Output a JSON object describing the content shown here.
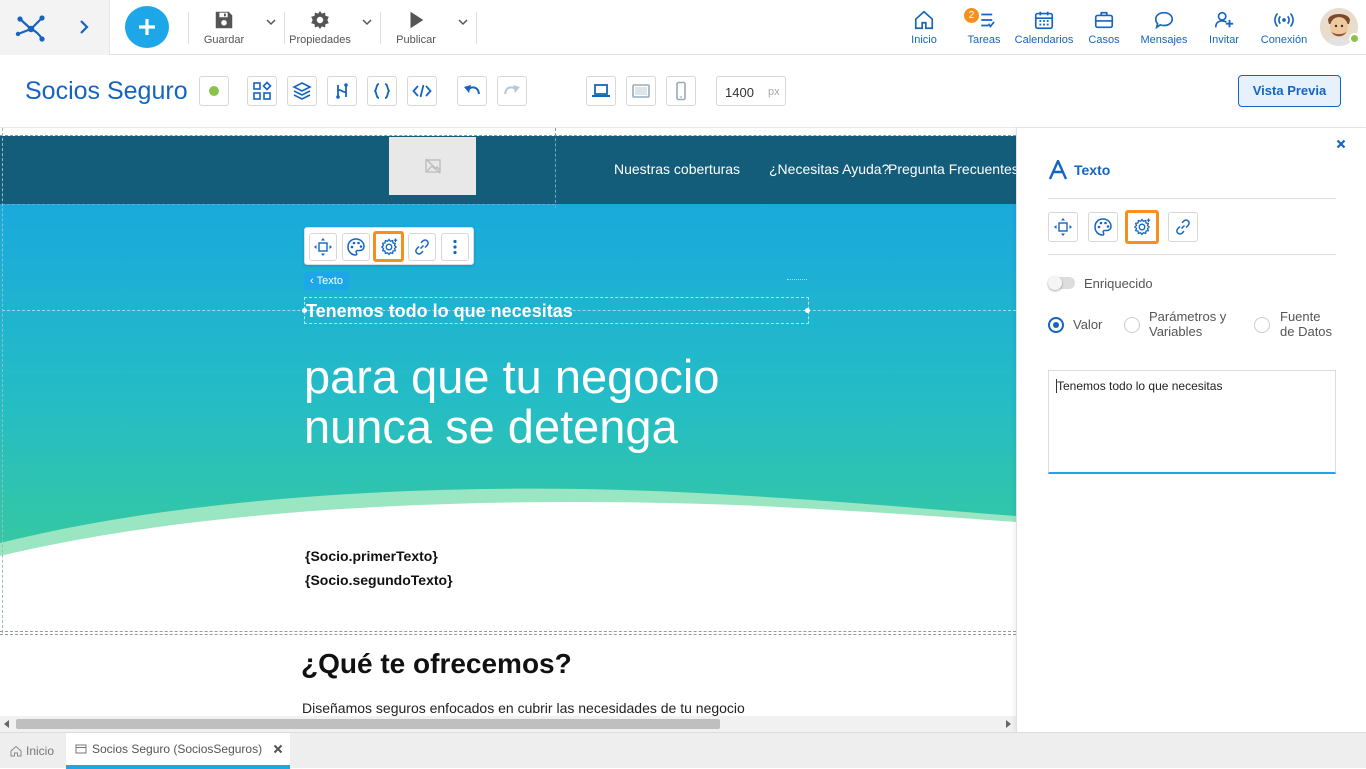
{
  "topbar": {
    "save_label": "Guardar",
    "properties_label": "Propiedades",
    "publish_label": "Publicar",
    "nav": [
      {
        "label": "Inicio",
        "icon": "home-icon"
      },
      {
        "label": "Tareas",
        "icon": "tasks-icon",
        "badge": "2"
      },
      {
        "label": "Calendarios",
        "icon": "calendar-icon"
      },
      {
        "label": "Casos",
        "icon": "briefcase-icon"
      },
      {
        "label": "Mensajes",
        "icon": "chat-icon"
      },
      {
        "label": "Invitar",
        "icon": "add-user-icon"
      },
      {
        "label": "Conexión",
        "icon": "connection-icon"
      }
    ]
  },
  "toolbar": {
    "page_title": "Socios Seguro",
    "width_value": "1400",
    "width_unit": "px",
    "preview_label": "Vista Previa"
  },
  "canvas": {
    "nav_links": [
      "Nuestras coberturas",
      "¿Necesitas Ayuda?",
      "Pregunta Frecuentes"
    ],
    "element_tag": "Texto",
    "hero_small": "Tenemos todo lo que necesitas",
    "hero_line1": "para que tu negocio",
    "hero_line2": "nunca se detenga",
    "var1": "{Socio.primerTexto}",
    "var2": "{Socio.segundoTexto}",
    "section_title": "¿Qué te ofrecemos?",
    "section_text": "Diseñamos seguros enfocados en cubrir las necesidades de tu negocio"
  },
  "panel": {
    "title": "Texto",
    "enriched_label": "Enriquecido",
    "enriched_on": false,
    "radio_value": "Valor",
    "radio_params": "Parámetros y Variables",
    "radio_params_l1": "Parámetros y",
    "radio_params_l2": "Variables",
    "radio_source_l1": "Fuente",
    "radio_source_l2": "de Datos",
    "selected_radio": "Valor",
    "text_value": "Tenemos todo lo que necesitas"
  },
  "statusbar": {
    "tabs": [
      {
        "label": "Inicio",
        "active": false
      },
      {
        "label": "Socios Seguro (SociosSeguros)",
        "active": true
      }
    ]
  },
  "colors": {
    "accent": "#1565c0",
    "hero_top": "#1aa9dc",
    "hero_bottom": "#3ecf8e",
    "navbar": "#135d7a",
    "highlight": "#f5901f",
    "status_green": "#8bc34a"
  }
}
